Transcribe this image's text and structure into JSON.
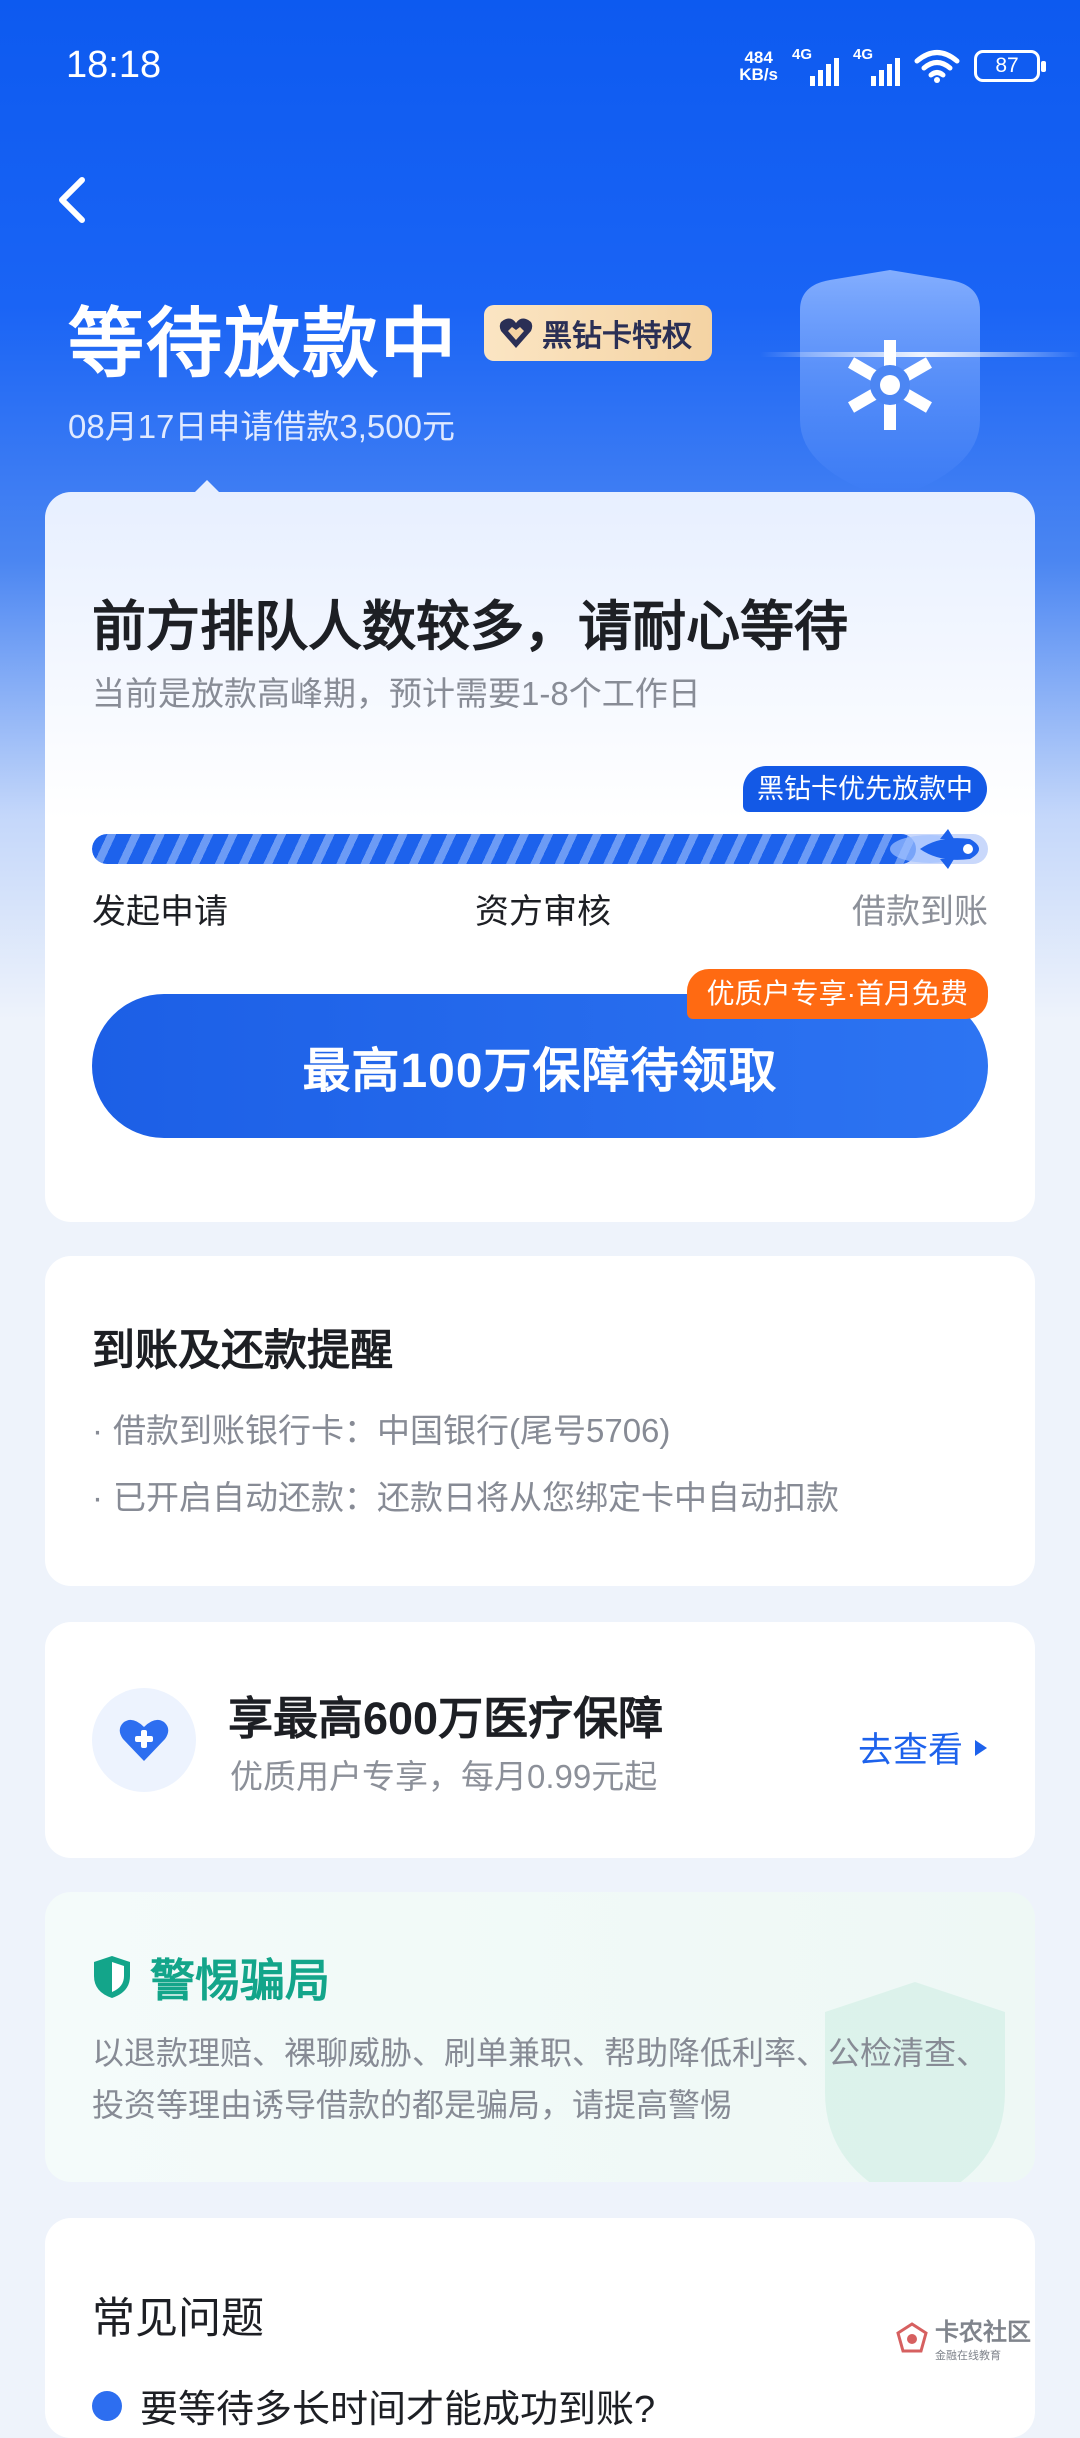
{
  "status_bar": {
    "time": "18:18",
    "net_speed_value": "484",
    "net_speed_unit": "KB/s",
    "network_1": "4G",
    "network_2": "4G",
    "battery": "87"
  },
  "header": {
    "title": "等待放款中",
    "vip_badge": "黑钻卡特权",
    "subtitle": "08月17日申请借款3,500元",
    "icons": {
      "back": "chevron-left-icon",
      "vip": "heart-diamond-icon"
    }
  },
  "status_card": {
    "title": "前方排队人数较多，请耐心等待",
    "subtitle": "当前是放款高峰期，预计需要1-8个工作日",
    "priority_badge": "黑钻卡优先放款中",
    "progress": 0.92,
    "steps": [
      "发起申请",
      "资方审核",
      "借款到账"
    ],
    "cta_label": "最高100万保障待领取",
    "cta_badge": "优质户专享·首月免费",
    "colors": {
      "primary": "#1d62ec",
      "badge_orange": "#ff6a12"
    }
  },
  "reminder": {
    "title": "到账及还款提醒",
    "lines": [
      "借款到账银行卡：中国银行(尾号5706)",
      "已开启自动还款：还款日将从您绑定卡中自动扣款"
    ]
  },
  "medical": {
    "title": "享最高600万医疗保障",
    "subtitle": "优质用户专享，每月0.99元起",
    "link": "去查看",
    "icons": {
      "main": "medical-heart-icon",
      "link": "triangle-right-icon"
    }
  },
  "fraud": {
    "title": "警惕骗局",
    "text": "以退款理赔、裸聊威胁、刷单兼职、帮助降低利率、公检清查、投资等理由诱导借款的都是骗局，请提高警惕",
    "color": "#13a58a"
  },
  "faq": {
    "title": "常见问题",
    "first_question": "要等待多长时间才能成功到账?"
  },
  "watermark": {
    "name": "卡农社区",
    "tagline": "金融在线教育"
  }
}
